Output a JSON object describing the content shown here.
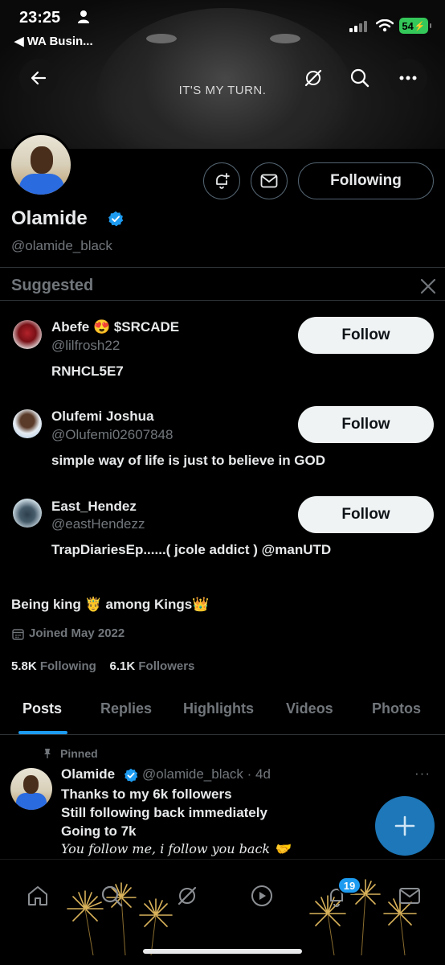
{
  "status_bar": {
    "time": "23:25",
    "back_app": "◀ WA Busin...",
    "battery": "54"
  },
  "banner": {
    "text": "IT'S MY TURN."
  },
  "header_icons": {
    "back": "arrow-left-icon",
    "grok": "grok-icon",
    "search": "search-icon",
    "more": "more-horizontal-icon"
  },
  "profile": {
    "name": "Olamide",
    "handle": "@olamide_black",
    "following_button": "Following",
    "bio": "Being king 🤴 among Kings👑",
    "joined": "Joined May 2022",
    "following_count": "5.8K",
    "following_label": "Following",
    "followers_count": "6.1K",
    "followers_label": "Followers"
  },
  "suggested": {
    "title": "Suggested",
    "follow_label": "Follow",
    "items": [
      {
        "name": "Abefe 😍 $SRCADE",
        "handle": "@lilfrosh22",
        "bio": "RNHCL5E7"
      },
      {
        "name": "Olufemi Joshua",
        "handle": "@Olufemi02607848",
        "bio": "simple way of life is just to believe in GOD"
      },
      {
        "name": "East_Hendez",
        "handle": "@eastHendezz",
        "bio": "TrapDiariesEp......( jcole addict ) @manUTD"
      }
    ]
  },
  "tabs": [
    "Posts",
    "Replies",
    "Highlights",
    "Videos",
    "Photos"
  ],
  "pinned_post": {
    "pinned_label": "Pinned",
    "author": "Olamide",
    "meta": "@olamide_black · 4d",
    "more": "···",
    "lines": [
      "Thanks to my 6k followers",
      "Still following back immediately",
      "Going to 7k"
    ],
    "italic_line": "You follow me, i  follow you back 🤝"
  },
  "bottom_nav": {
    "notifications_badge": "19"
  },
  "colors": {
    "accent": "#1d9bf0",
    "background": "#000000",
    "muted": "#71767b",
    "fab": "#1d77b8",
    "battery": "#34c759"
  }
}
